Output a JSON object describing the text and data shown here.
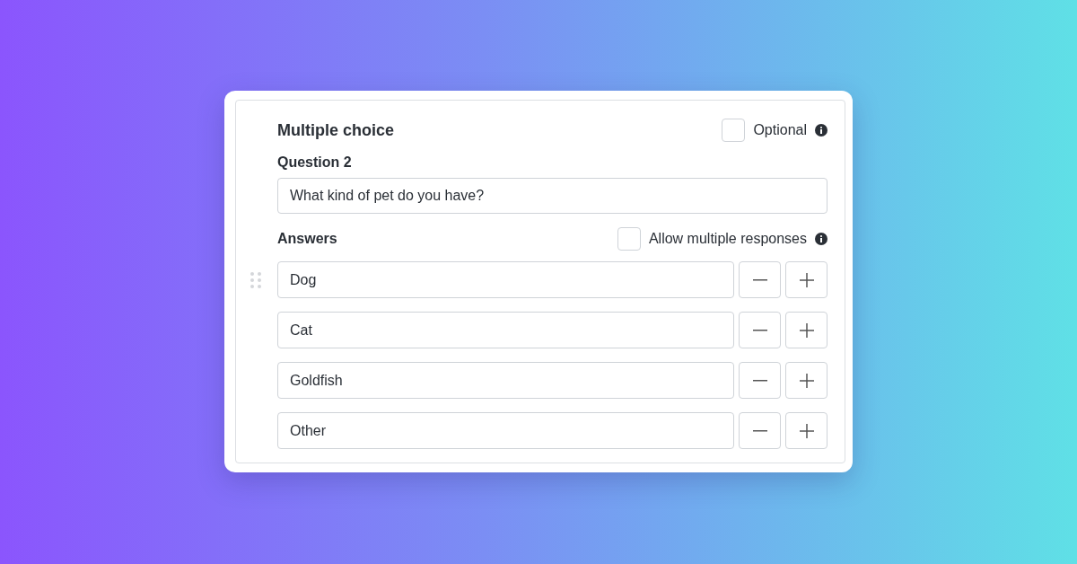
{
  "title": "Multiple choice",
  "optional": {
    "label": "Optional",
    "checked": false
  },
  "question": {
    "label": "Question 2",
    "value": "What kind of pet do you have?"
  },
  "answers_header": {
    "label": "Answers",
    "allow_multiple": {
      "label": "Allow multiple responses",
      "checked": false
    }
  },
  "answers": [
    {
      "value": "Dog",
      "show_handle": true
    },
    {
      "value": "Cat",
      "show_handle": false
    },
    {
      "value": "Goldfish",
      "show_handle": false
    },
    {
      "value": "Other",
      "show_handle": false
    }
  ]
}
